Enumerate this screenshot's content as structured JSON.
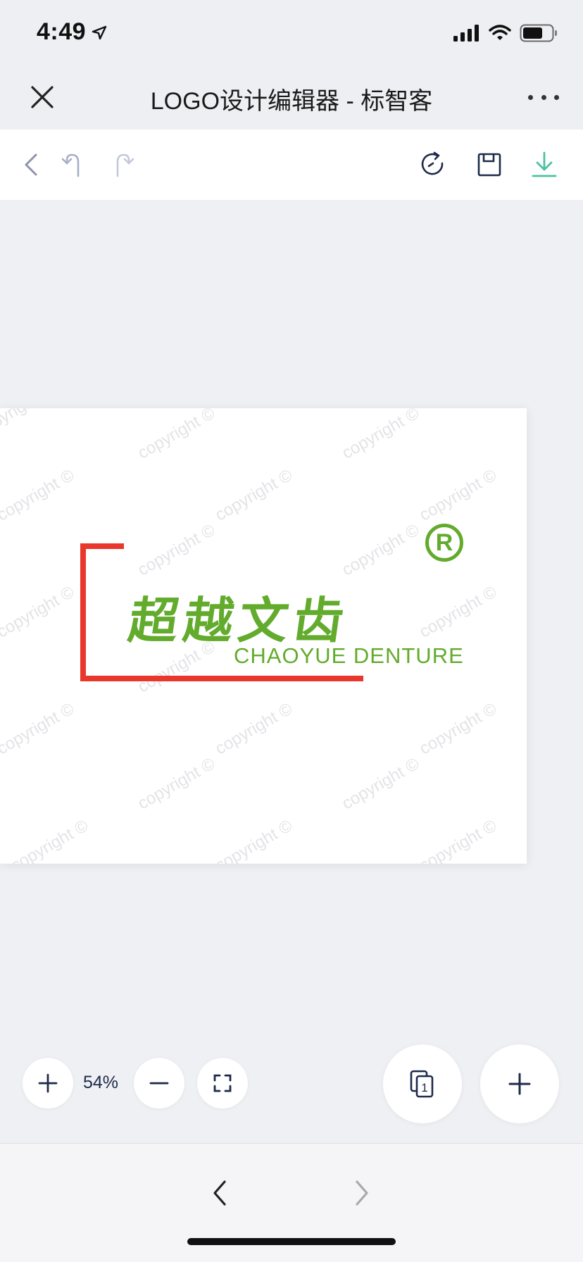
{
  "status": {
    "time": "4:49"
  },
  "title_bar": {
    "title": "LOGO设计编辑器 - 标智客"
  },
  "logo": {
    "name_cn": "超越文齿",
    "name_en": "CHAOYUE DENTURE",
    "registered": "R",
    "colors": {
      "green": "#62ab2c",
      "red": "#e9372b"
    }
  },
  "watermark": {
    "text": "copyright ©"
  },
  "zoom": {
    "level": "54%"
  },
  "theme": {
    "accent": "#4cc2a3",
    "icon": "#1e2a4a",
    "disabled": "#a7aec6"
  },
  "icons": {
    "close": "close-icon",
    "more": "more-icon",
    "back": "back-icon",
    "undo": "undo-icon",
    "redo": "redo-icon",
    "refresh": "refresh-icon",
    "save": "save-icon",
    "download": "download-icon",
    "zoom_in": "plus-icon",
    "zoom_out": "minus-icon",
    "fit": "fullscreen-icon",
    "pages": "pages-icon",
    "add": "plus-icon",
    "prev": "chevron-left-icon",
    "next": "chevron-right-icon"
  },
  "pages": {
    "current": "1"
  }
}
